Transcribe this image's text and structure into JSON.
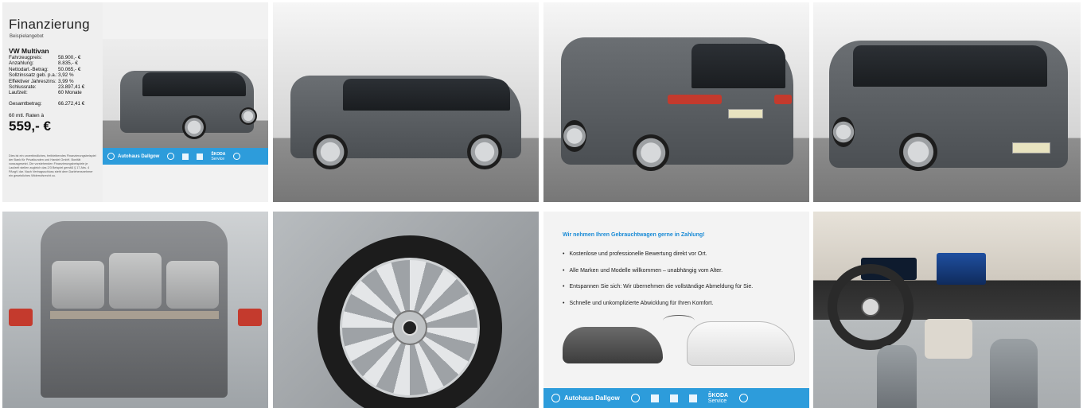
{
  "finance": {
    "title": "Finanzierung",
    "subtitle": "Beispielangebot",
    "model": "VW Multivan",
    "rows": [
      {
        "label": "Fahrzeugpreis:",
        "value": "58.900,- €"
      },
      {
        "label": "Anzahlung:",
        "value": "8.835,- €"
      },
      {
        "label": "Nettodarl.-Betrag:",
        "value": "50.065,- €"
      },
      {
        "label": "Sollzinssatz geb. p.a.:",
        "value": "3,92 %"
      },
      {
        "label": "Effektiver Jahreszins:",
        "value": "3,99 %"
      },
      {
        "label": "Schlussrate:",
        "value": "23.897,41 €"
      },
      {
        "label": "Laufzeit:",
        "value": "60 Monate"
      }
    ],
    "total_label": "Gesamtbetrag:",
    "total_value": "66.272,41 €",
    "rate_label": "60 mtl. Raten à",
    "rate_value": "559,- €",
    "disclaimer": "Dies ist ein unverbindliches, freibleibendes Finanzierungsbeispiel der Bank für Privatkunden und Handel GmbH. Bonität vorausgesetzt. Die vorstehenden Finanzierungsbeispiele je Laufzeit stellen zugleich das 2/3 Beispiel gemäß § 17 Abs. 4 PAngV dar. Nach Vertragsschluss steht dem Darlehensnehmer ein gesetzliches Widerrufsrecht zu.",
    "dealer_label": "Autohaus Dallgow",
    "skoda_label": "ŠKODA",
    "skoda_sub": "Service"
  },
  "tradein": {
    "heading": "Wir nehmen Ihren Gebrauchtwagen gerne in Zahlung!",
    "items": [
      "Kostenlose und professionelle Bewertung direkt vor Ort.",
      "Alle Marken und Modelle willkommen – unabhängig vom Alter.",
      "Entspannen Sie sich: Wir übernehmen die vollständige Abmeldung für Sie.",
      "Schnelle und unkomplizierte Abwicklung für Ihren Komfort."
    ],
    "dealer_label": "Autohaus Dallgow",
    "skoda_label": "ŠKODA",
    "skoda_sub": "Service"
  },
  "colors": {
    "accent": "#2d9cdb",
    "heading": "#1a8bd6",
    "car_body": "#55595d"
  }
}
